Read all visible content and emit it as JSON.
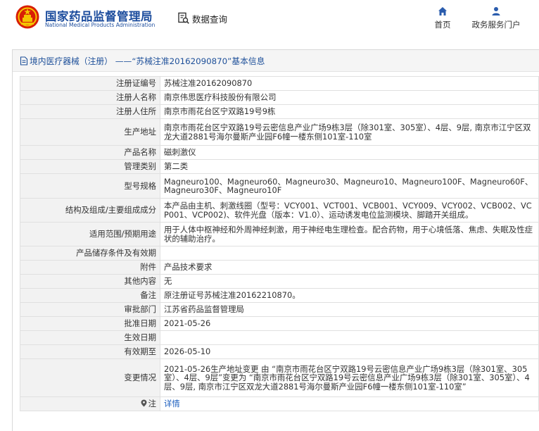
{
  "header": {
    "brand_cn": "国家药品监督管理局",
    "brand_en": "National Medical Products Administration",
    "db_query": "数据查询",
    "nav": [
      {
        "label": "首页",
        "icon": "home-icon"
      },
      {
        "label": "政务服务门户",
        "icon": "user-icon"
      }
    ]
  },
  "breadcrumb": "境内医疗器械（注册） ——“苏械注准20162090870”基本信息",
  "rows": [
    {
      "label": "注册证编号",
      "value": "苏械注准20162090870"
    },
    {
      "label": "注册人名称",
      "value": "南京伟思医疗科技股份有限公司"
    },
    {
      "label": "注册人住所",
      "value": "南京市雨花台区宁双路19号9栋"
    },
    {
      "label": "生产地址",
      "value": "南京市雨花台区宁双路19号云密信息产业广场9栋3层（除301室、305室）、4层、9层, 南京市江宁区双龙大道2881号海尔曼斯产业园F6幢一楼东侧101室-110室"
    },
    {
      "label": "产品名称",
      "value": "磁刺激仪"
    },
    {
      "label": "管理类别",
      "value": "第二类"
    },
    {
      "label": "型号规格",
      "value": "Magneuro100、Magneuro60、Magneuro30、Magneuro10、Magneuro100F、Magneuro60F、Magneuro30F、Magneuro10F"
    },
    {
      "label": "结构及组成/主要组成成分",
      "value": "本产品由主机、刺激线圈（型号：VCY001、VCT001、VCB001、VCY009、VCY002、VCB002、VCP001、VCP002)、软件光盘（版本：V1.0）、运动诱发电位监测模块、脚踏开关组成。"
    },
    {
      "label": "适用范围/预期用途",
      "value": "用于人体中枢神经和外周神经刺激，用于神经电生理检查。配合药物，用于心境低落、焦虑、失眠及性症状的辅助治疗。"
    },
    {
      "label": "产品储存条件及有效期",
      "value": ""
    },
    {
      "label": "附件",
      "value": "产品技术要求"
    },
    {
      "label": "其他内容",
      "value": "无"
    },
    {
      "label": "备注",
      "value": "原注册证号苏械注准20162210870。"
    },
    {
      "label": "审批部门",
      "value": "江苏省药品监督管理局"
    },
    {
      "label": "批准日期",
      "value": "2021-05-26"
    },
    {
      "label": "生效日期",
      "value": ""
    },
    {
      "label": "有效期至",
      "value": "2026-05-10"
    },
    {
      "label": "变更情况",
      "value": "2021-05-26生产地址变更 由 “南京市雨花台区宁双路19号云密信息产业广场9栋3层（除301室、305室）、4层、9层”变更为 “南京市雨花台区宁双路19号云密信息产业广场9栋3层（除301室、305室）、4层、9层, 南京市江宁区双龙大道2881号海尔曼斯产业园F6幢一楼东侧101室-110室”"
    },
    {
      "label": "注",
      "value": "详情",
      "link": true
    }
  ]
}
